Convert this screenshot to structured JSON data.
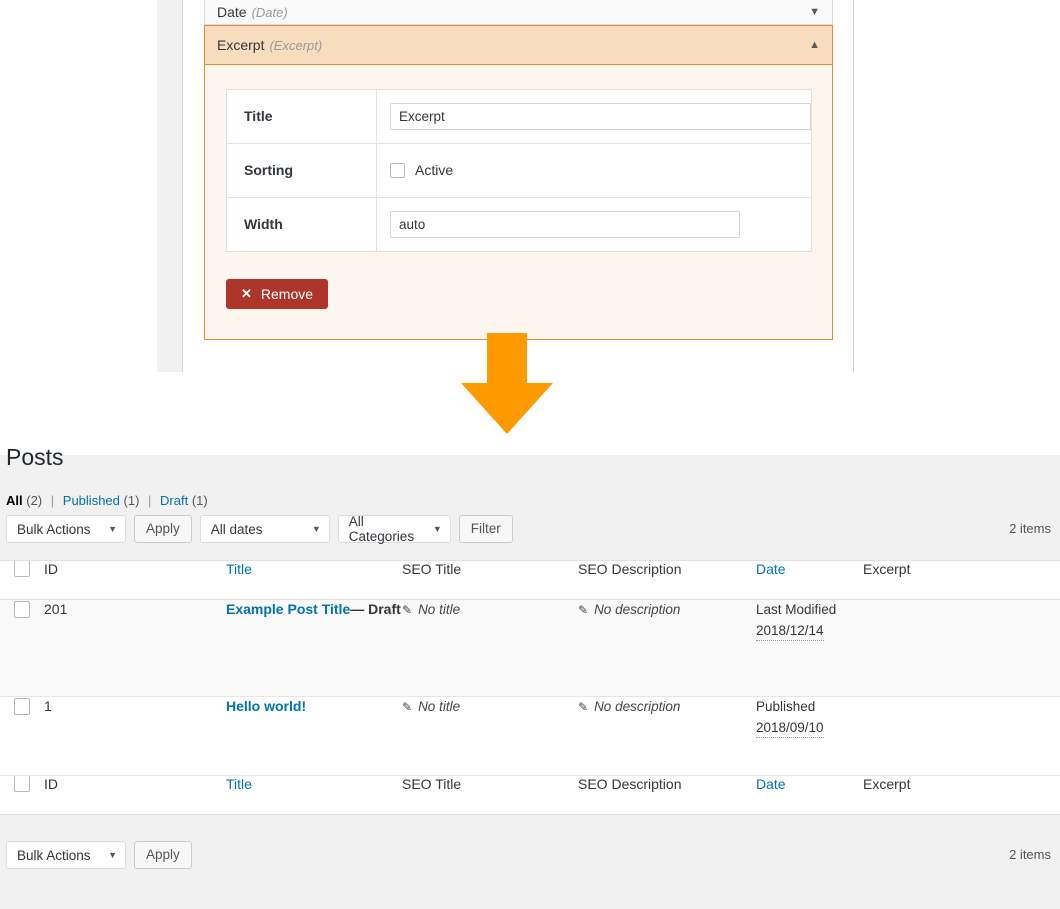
{
  "settings_panel": {
    "collapsed_row": {
      "title": "Date",
      "subtitle": "(Date)",
      "caret": "▼"
    },
    "open_row": {
      "title": "Excerpt",
      "subtitle": "(Excerpt)",
      "caret": "▲"
    },
    "fields": {
      "title_label": "Title",
      "title_value": "Excerpt",
      "sorting_label": "Sorting",
      "sorting_checkbox_label": "Active",
      "width_label": "Width",
      "width_value": "auto"
    },
    "remove_button": {
      "label": "Remove",
      "icon": "✕",
      "color": "#ad3529"
    }
  },
  "arrow": {
    "direction": "down",
    "color": "#ff9900"
  },
  "wp_list": {
    "heading": "Posts",
    "views": [
      {
        "label": "All",
        "count": "(2)",
        "current": true
      },
      {
        "label": "Published",
        "count": "(1)",
        "current": false
      },
      {
        "label": "Draft",
        "count": "(1)",
        "current": false
      }
    ],
    "separator": "|",
    "toolbar_top": {
      "bulk_actions": "Bulk Actions",
      "apply": "Apply",
      "dates": "All dates",
      "categories": "All Categories",
      "filter": "Filter",
      "items": "2 items",
      "arrow": "▼"
    },
    "toolbar_bottom": {
      "bulk_actions": "Bulk Actions",
      "apply": "Apply",
      "items": "2 items",
      "arrow": "▼"
    },
    "columns": [
      {
        "label": "ID",
        "sortable": false
      },
      {
        "label": "Title",
        "sortable": true
      },
      {
        "label": "SEO Title",
        "sortable": false
      },
      {
        "label": "SEO Description",
        "sortable": false
      },
      {
        "label": "Date",
        "sortable": true
      },
      {
        "label": "Excerpt",
        "sortable": false
      }
    ],
    "rows": [
      {
        "id": "201",
        "title": "Example Post Title",
        "title_dash": "—",
        "state": "Draft",
        "seo_title": "No title",
        "seo_description": "No description",
        "date_status": "Last Modified",
        "date_value": "2018/12/14",
        "excerpt": "",
        "pencil": "✎"
      },
      {
        "id": "1",
        "title": "Hello world!",
        "title_dash": "",
        "state": "",
        "seo_title": "No title",
        "seo_description": "No description",
        "date_status": "Published",
        "date_value": "2018/09/10",
        "excerpt": "",
        "pencil": "✎"
      }
    ]
  }
}
